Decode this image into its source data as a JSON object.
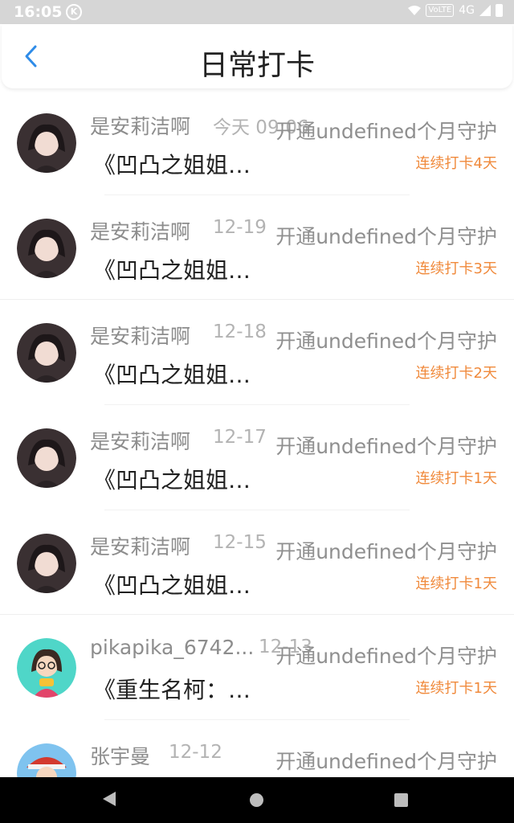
{
  "status_bar": {
    "time": "16:05",
    "k_icon": "K",
    "volte": "VoLTE",
    "network": "4G"
  },
  "header": {
    "title": "日常打卡"
  },
  "rows": [
    {
      "user": "是安莉洁啊",
      "date": "今天 09:06",
      "guard": "开通undefined个月守护",
      "book": "《凹凸之姐姐…",
      "streak": "连续打卡4天",
      "avatar": "girl-avatar"
    },
    {
      "user": "是安莉洁啊",
      "date": "12-19",
      "guard": "开通undefined个月守护",
      "book": "《凹凸之姐姐…",
      "streak": "连续打卡3天",
      "avatar": "girl-avatar"
    },
    {
      "user": "是安莉洁啊",
      "date": "12-18",
      "guard": "开通undefined个月守护",
      "book": "《凹凸之姐姐…",
      "streak": "连续打卡2天",
      "avatar": "girl-avatar"
    },
    {
      "user": "是安莉洁啊",
      "date": "12-17",
      "guard": "开通undefined个月守护",
      "book": "《凹凸之姐姐…",
      "streak": "连续打卡1天",
      "avatar": "girl-avatar"
    },
    {
      "user": "是安莉洁啊",
      "date": "12-15",
      "guard": "开通undefined个月守护",
      "book": "《凹凸之姐姐…",
      "streak": "连续打卡1天",
      "avatar": "girl-avatar"
    },
    {
      "user": "pikapika_6742...",
      "date": "12-13",
      "guard": "开通undefined个月守护",
      "book": "《重生名柯：…",
      "streak": "连续打卡1天",
      "avatar": "cartoon-girl-avatar"
    },
    {
      "user": "张宇曼",
      "date": "12-12",
      "guard": "开通undefined个月守护",
      "book": "",
      "streak": "",
      "avatar": "cartoon-boy-avatar"
    }
  ],
  "colors": {
    "accent": "#2f8ce8",
    "streak": "#f08a3c",
    "muted": "#8d8d8d"
  }
}
